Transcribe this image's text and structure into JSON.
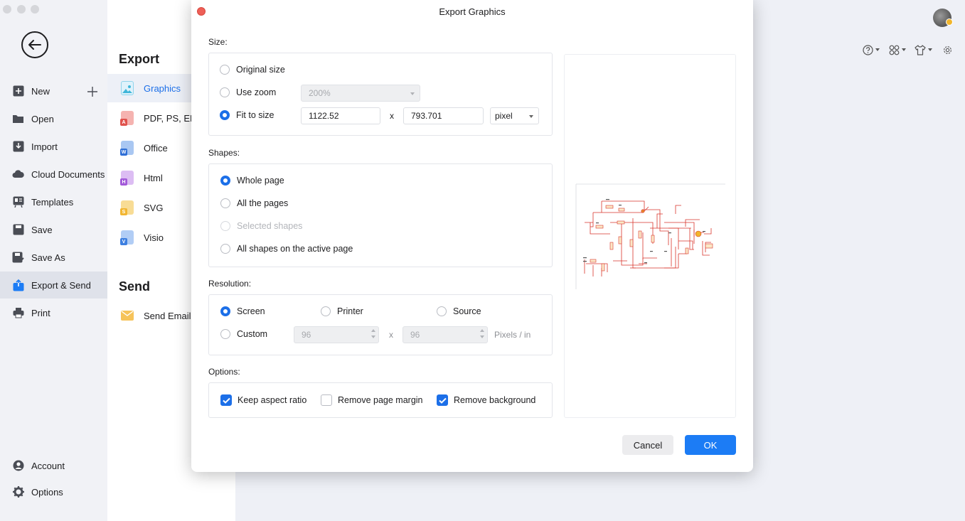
{
  "sidebar": {
    "items": [
      {
        "label": "New",
        "icon": "plus-square-icon"
      },
      {
        "label": "Open",
        "icon": "folder-icon"
      },
      {
        "label": "Import",
        "icon": "import-icon"
      },
      {
        "label": "Cloud Documents",
        "icon": "cloud-icon"
      },
      {
        "label": "Templates",
        "icon": "templates-icon"
      },
      {
        "label": "Save",
        "icon": "save-icon"
      },
      {
        "label": "Save As",
        "icon": "save-as-icon"
      },
      {
        "label": "Export & Send",
        "icon": "export-icon",
        "active": true
      },
      {
        "label": "Print",
        "icon": "print-icon"
      }
    ],
    "bottom": [
      {
        "label": "Account",
        "icon": "account-icon"
      },
      {
        "label": "Options",
        "icon": "gear-icon"
      }
    ]
  },
  "panel": {
    "export_title": "Export",
    "export_items": [
      {
        "label": "Graphics",
        "color": "#3fb6d9",
        "badge": "",
        "active": true
      },
      {
        "label": "PDF, PS, EPS",
        "color": "#e0524d",
        "badge": "A"
      },
      {
        "label": "Office",
        "color": "#2f6fd6",
        "badge": "W"
      },
      {
        "label": "Html",
        "color": "#a259d9",
        "badge": "H"
      },
      {
        "label": "SVG",
        "color": "#f2b632",
        "badge": "S"
      },
      {
        "label": "Visio",
        "color": "#3d7fe0",
        "badge": "V"
      }
    ],
    "send_title": "Send",
    "send_items": [
      {
        "label": "Send Email",
        "color": "#f4b942"
      }
    ]
  },
  "dialog": {
    "title": "Export Graphics",
    "size": {
      "title": "Size:",
      "original": "Original size",
      "use_zoom": "Use zoom",
      "zoom_value": "200%",
      "fit": "Fit to size",
      "width": "1122.52",
      "height": "793.701",
      "x": "x",
      "unit": "pixel"
    },
    "shapes": {
      "title": "Shapes:",
      "whole": "Whole page",
      "all": "All the pages",
      "selected": "Selected shapes",
      "active": "All shapes on the active page"
    },
    "resolution": {
      "title": "Resolution:",
      "screen": "Screen",
      "printer": "Printer",
      "source": "Source",
      "custom": "Custom",
      "w": "96",
      "h": "96",
      "x": "x",
      "unit": "Pixels / in"
    },
    "options": {
      "title": "Options:",
      "keep_aspect": "Keep aspect ratio",
      "remove_margin": "Remove page margin",
      "remove_bg": "Remove background",
      "keep_aspect_checked": true,
      "remove_margin_checked": false,
      "remove_bg_checked": true
    },
    "cancel": "Cancel",
    "ok": "OK"
  },
  "colors": {
    "accent": "#1c6fe8",
    "ok_button": "#1c7cf5",
    "circuit": "#d9352b"
  }
}
